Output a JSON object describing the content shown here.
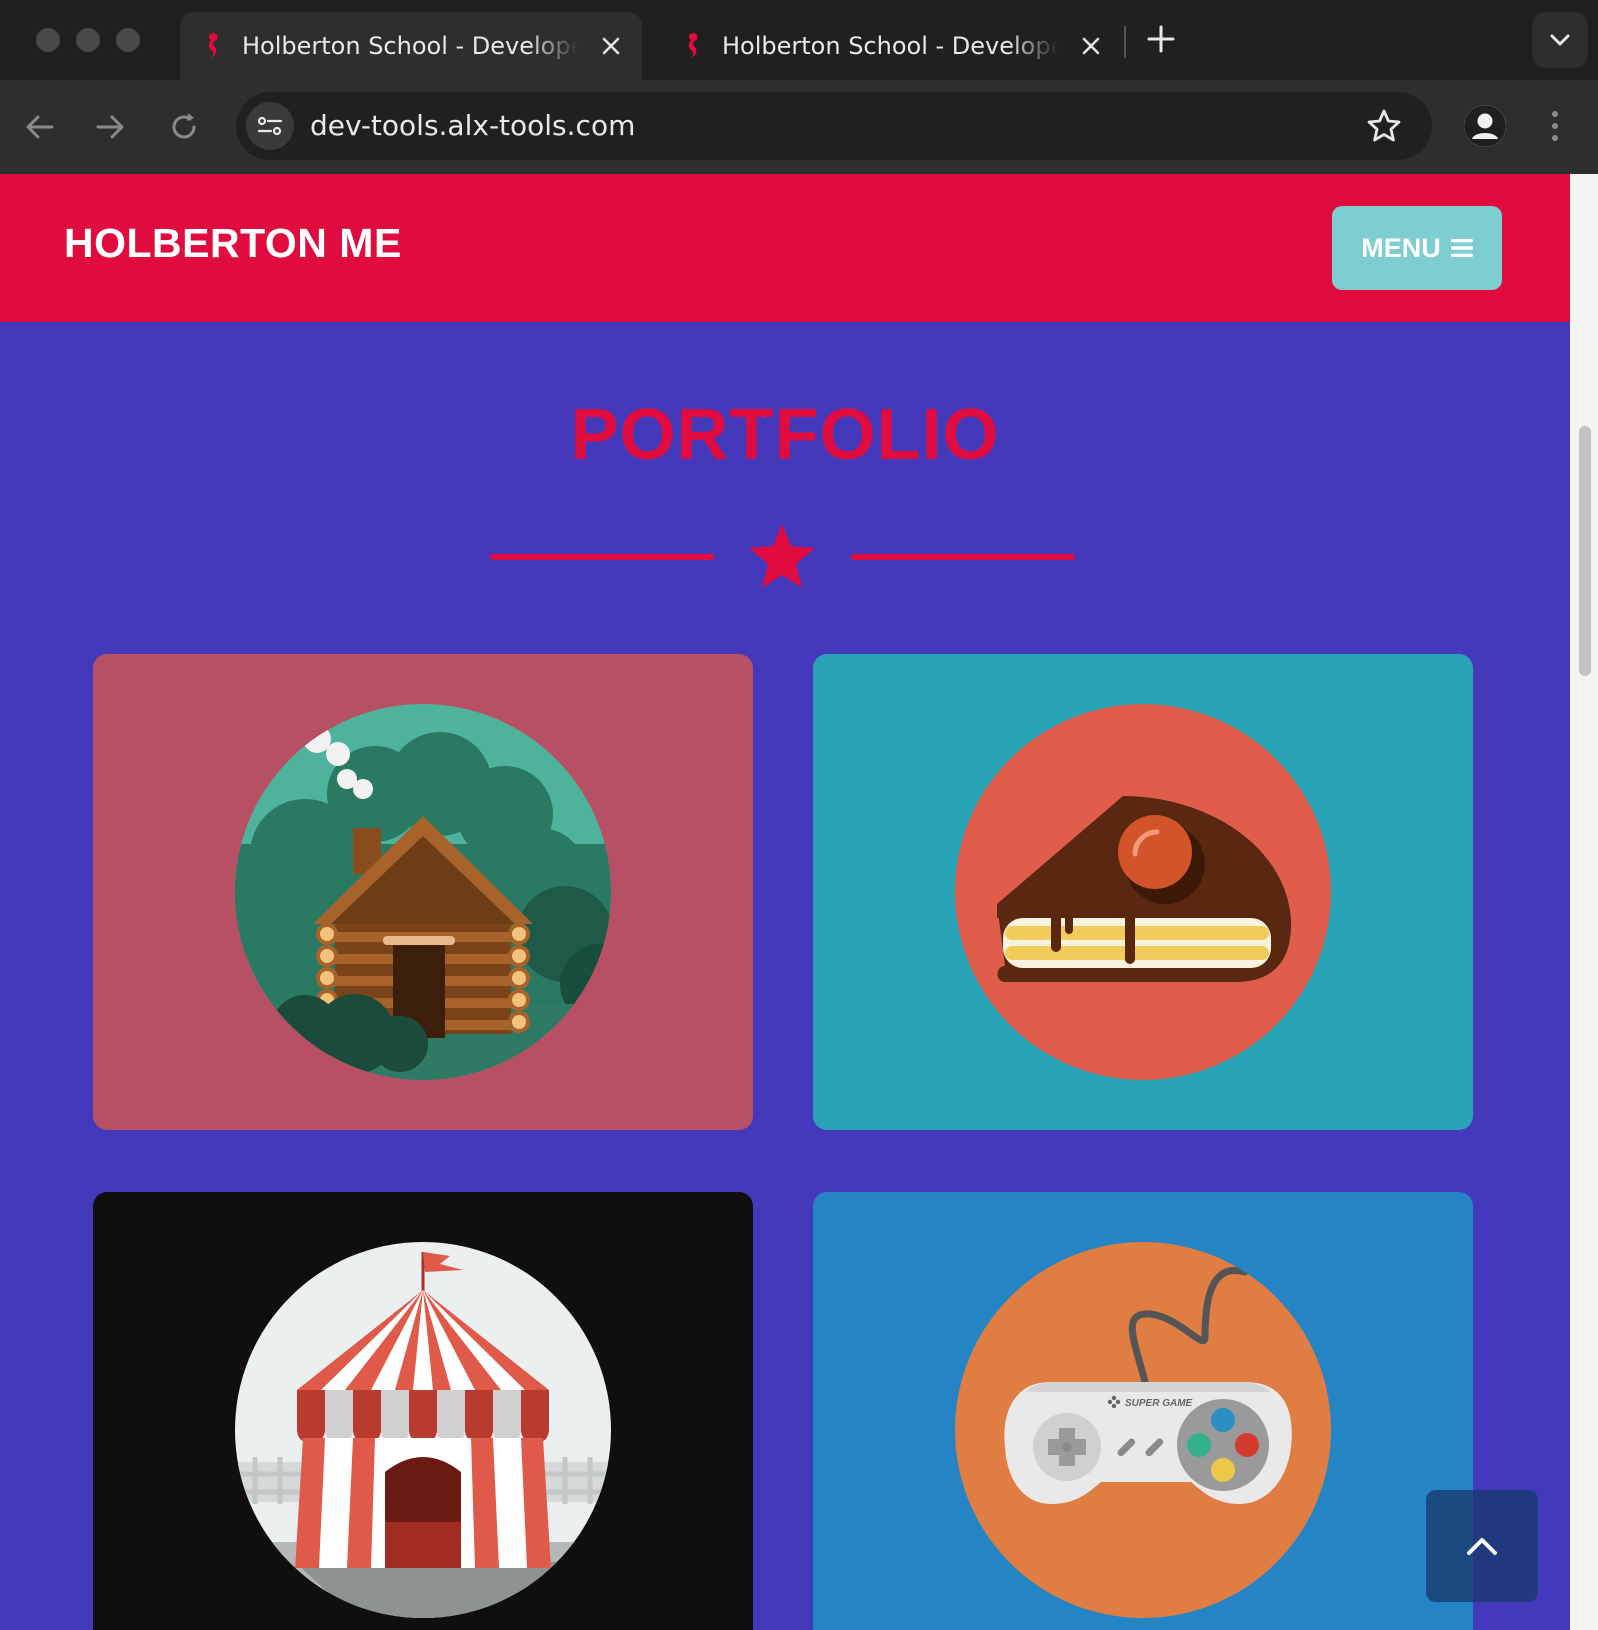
{
  "browser": {
    "tabs": [
      {
        "title": "Holberton School - Developer Tools",
        "active": true
      },
      {
        "title": "Holberton School - Developer Tools",
        "active": false
      }
    ],
    "url": "dev-tools.alx-tools.com"
  },
  "header": {
    "brand": "HOLBERTON ME",
    "menu_label": "MENU"
  },
  "portfolio": {
    "title": "PORTFOLIO",
    "items": [
      {
        "icon": "log-cabin-icon"
      },
      {
        "icon": "cake-slice-icon"
      },
      {
        "icon": "circus-tent-icon"
      },
      {
        "icon": "game-controller-icon",
        "controller_text": "SUPER GAME"
      }
    ]
  },
  "colors": {
    "header_bg": "#e00c40",
    "page_bg": "#4439bb",
    "accent": "#e00c40",
    "menu_button": "#7ecdd1",
    "card_cabin": "#b75064",
    "card_cake": "#29a4b6",
    "card_circus": "#110e0e",
    "card_controller": "#2585c4"
  }
}
